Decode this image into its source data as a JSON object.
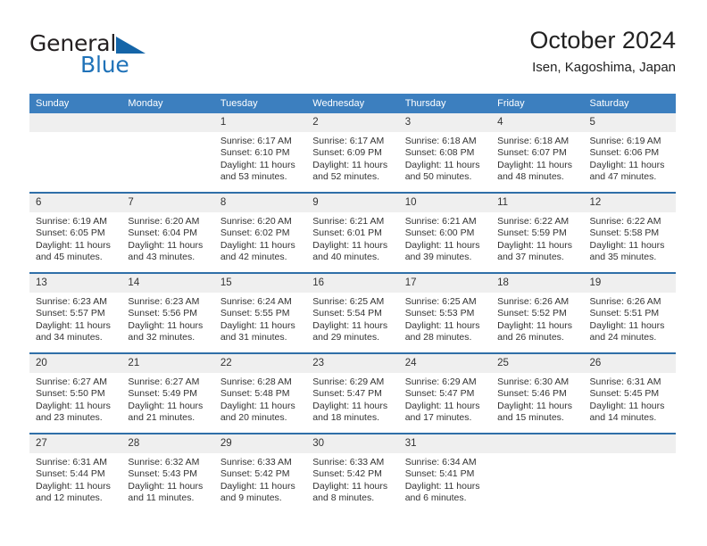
{
  "brand": {
    "name_part1": "General",
    "name_part2": "Blue",
    "flag_icon": "triangle-flag-icon",
    "accent_color": "#1f72b8"
  },
  "header": {
    "title": "October 2024",
    "subtitle": "Isen, Kagoshima, Japan"
  },
  "theme": {
    "header_blue": "#3c7fbf",
    "divider_blue": "#2f6fa8",
    "daynum_gray": "#efefef"
  },
  "weekday_headers": [
    "Sunday",
    "Monday",
    "Tuesday",
    "Wednesday",
    "Thursday",
    "Friday",
    "Saturday"
  ],
  "weeks": [
    [
      {
        "day": "",
        "sunrise": "",
        "sunset": "",
        "daylight1": "",
        "daylight2": ""
      },
      {
        "day": "",
        "sunrise": "",
        "sunset": "",
        "daylight1": "",
        "daylight2": ""
      },
      {
        "day": "1",
        "sunrise": "Sunrise: 6:17 AM",
        "sunset": "Sunset: 6:10 PM",
        "daylight1": "Daylight: 11 hours",
        "daylight2": "and 53 minutes."
      },
      {
        "day": "2",
        "sunrise": "Sunrise: 6:17 AM",
        "sunset": "Sunset: 6:09 PM",
        "daylight1": "Daylight: 11 hours",
        "daylight2": "and 52 minutes."
      },
      {
        "day": "3",
        "sunrise": "Sunrise: 6:18 AM",
        "sunset": "Sunset: 6:08 PM",
        "daylight1": "Daylight: 11 hours",
        "daylight2": "and 50 minutes."
      },
      {
        "day": "4",
        "sunrise": "Sunrise: 6:18 AM",
        "sunset": "Sunset: 6:07 PM",
        "daylight1": "Daylight: 11 hours",
        "daylight2": "and 48 minutes."
      },
      {
        "day": "5",
        "sunrise": "Sunrise: 6:19 AM",
        "sunset": "Sunset: 6:06 PM",
        "daylight1": "Daylight: 11 hours",
        "daylight2": "and 47 minutes."
      }
    ],
    [
      {
        "day": "6",
        "sunrise": "Sunrise: 6:19 AM",
        "sunset": "Sunset: 6:05 PM",
        "daylight1": "Daylight: 11 hours",
        "daylight2": "and 45 minutes."
      },
      {
        "day": "7",
        "sunrise": "Sunrise: 6:20 AM",
        "sunset": "Sunset: 6:04 PM",
        "daylight1": "Daylight: 11 hours",
        "daylight2": "and 43 minutes."
      },
      {
        "day": "8",
        "sunrise": "Sunrise: 6:20 AM",
        "sunset": "Sunset: 6:02 PM",
        "daylight1": "Daylight: 11 hours",
        "daylight2": "and 42 minutes."
      },
      {
        "day": "9",
        "sunrise": "Sunrise: 6:21 AM",
        "sunset": "Sunset: 6:01 PM",
        "daylight1": "Daylight: 11 hours",
        "daylight2": "and 40 minutes."
      },
      {
        "day": "10",
        "sunrise": "Sunrise: 6:21 AM",
        "sunset": "Sunset: 6:00 PM",
        "daylight1": "Daylight: 11 hours",
        "daylight2": "and 39 minutes."
      },
      {
        "day": "11",
        "sunrise": "Sunrise: 6:22 AM",
        "sunset": "Sunset: 5:59 PM",
        "daylight1": "Daylight: 11 hours",
        "daylight2": "and 37 minutes."
      },
      {
        "day": "12",
        "sunrise": "Sunrise: 6:22 AM",
        "sunset": "Sunset: 5:58 PM",
        "daylight1": "Daylight: 11 hours",
        "daylight2": "and 35 minutes."
      }
    ],
    [
      {
        "day": "13",
        "sunrise": "Sunrise: 6:23 AM",
        "sunset": "Sunset: 5:57 PM",
        "daylight1": "Daylight: 11 hours",
        "daylight2": "and 34 minutes."
      },
      {
        "day": "14",
        "sunrise": "Sunrise: 6:23 AM",
        "sunset": "Sunset: 5:56 PM",
        "daylight1": "Daylight: 11 hours",
        "daylight2": "and 32 minutes."
      },
      {
        "day": "15",
        "sunrise": "Sunrise: 6:24 AM",
        "sunset": "Sunset: 5:55 PM",
        "daylight1": "Daylight: 11 hours",
        "daylight2": "and 31 minutes."
      },
      {
        "day": "16",
        "sunrise": "Sunrise: 6:25 AM",
        "sunset": "Sunset: 5:54 PM",
        "daylight1": "Daylight: 11 hours",
        "daylight2": "and 29 minutes."
      },
      {
        "day": "17",
        "sunrise": "Sunrise: 6:25 AM",
        "sunset": "Sunset: 5:53 PM",
        "daylight1": "Daylight: 11 hours",
        "daylight2": "and 28 minutes."
      },
      {
        "day": "18",
        "sunrise": "Sunrise: 6:26 AM",
        "sunset": "Sunset: 5:52 PM",
        "daylight1": "Daylight: 11 hours",
        "daylight2": "and 26 minutes."
      },
      {
        "day": "19",
        "sunrise": "Sunrise: 6:26 AM",
        "sunset": "Sunset: 5:51 PM",
        "daylight1": "Daylight: 11 hours",
        "daylight2": "and 24 minutes."
      }
    ],
    [
      {
        "day": "20",
        "sunrise": "Sunrise: 6:27 AM",
        "sunset": "Sunset: 5:50 PM",
        "daylight1": "Daylight: 11 hours",
        "daylight2": "and 23 minutes."
      },
      {
        "day": "21",
        "sunrise": "Sunrise: 6:27 AM",
        "sunset": "Sunset: 5:49 PM",
        "daylight1": "Daylight: 11 hours",
        "daylight2": "and 21 minutes."
      },
      {
        "day": "22",
        "sunrise": "Sunrise: 6:28 AM",
        "sunset": "Sunset: 5:48 PM",
        "daylight1": "Daylight: 11 hours",
        "daylight2": "and 20 minutes."
      },
      {
        "day": "23",
        "sunrise": "Sunrise: 6:29 AM",
        "sunset": "Sunset: 5:47 PM",
        "daylight1": "Daylight: 11 hours",
        "daylight2": "and 18 minutes."
      },
      {
        "day": "24",
        "sunrise": "Sunrise: 6:29 AM",
        "sunset": "Sunset: 5:47 PM",
        "daylight1": "Daylight: 11 hours",
        "daylight2": "and 17 minutes."
      },
      {
        "day": "25",
        "sunrise": "Sunrise: 6:30 AM",
        "sunset": "Sunset: 5:46 PM",
        "daylight1": "Daylight: 11 hours",
        "daylight2": "and 15 minutes."
      },
      {
        "day": "26",
        "sunrise": "Sunrise: 6:31 AM",
        "sunset": "Sunset: 5:45 PM",
        "daylight1": "Daylight: 11 hours",
        "daylight2": "and 14 minutes."
      }
    ],
    [
      {
        "day": "27",
        "sunrise": "Sunrise: 6:31 AM",
        "sunset": "Sunset: 5:44 PM",
        "daylight1": "Daylight: 11 hours",
        "daylight2": "and 12 minutes."
      },
      {
        "day": "28",
        "sunrise": "Sunrise: 6:32 AM",
        "sunset": "Sunset: 5:43 PM",
        "daylight1": "Daylight: 11 hours",
        "daylight2": "and 11 minutes."
      },
      {
        "day": "29",
        "sunrise": "Sunrise: 6:33 AM",
        "sunset": "Sunset: 5:42 PM",
        "daylight1": "Daylight: 11 hours",
        "daylight2": "and 9 minutes."
      },
      {
        "day": "30",
        "sunrise": "Sunrise: 6:33 AM",
        "sunset": "Sunset: 5:42 PM",
        "daylight1": "Daylight: 11 hours",
        "daylight2": "and 8 minutes."
      },
      {
        "day": "31",
        "sunrise": "Sunrise: 6:34 AM",
        "sunset": "Sunset: 5:41 PM",
        "daylight1": "Daylight: 11 hours",
        "daylight2": "and 6 minutes."
      },
      {
        "day": "",
        "sunrise": "",
        "sunset": "",
        "daylight1": "",
        "daylight2": ""
      },
      {
        "day": "",
        "sunrise": "",
        "sunset": "",
        "daylight1": "",
        "daylight2": ""
      }
    ]
  ]
}
